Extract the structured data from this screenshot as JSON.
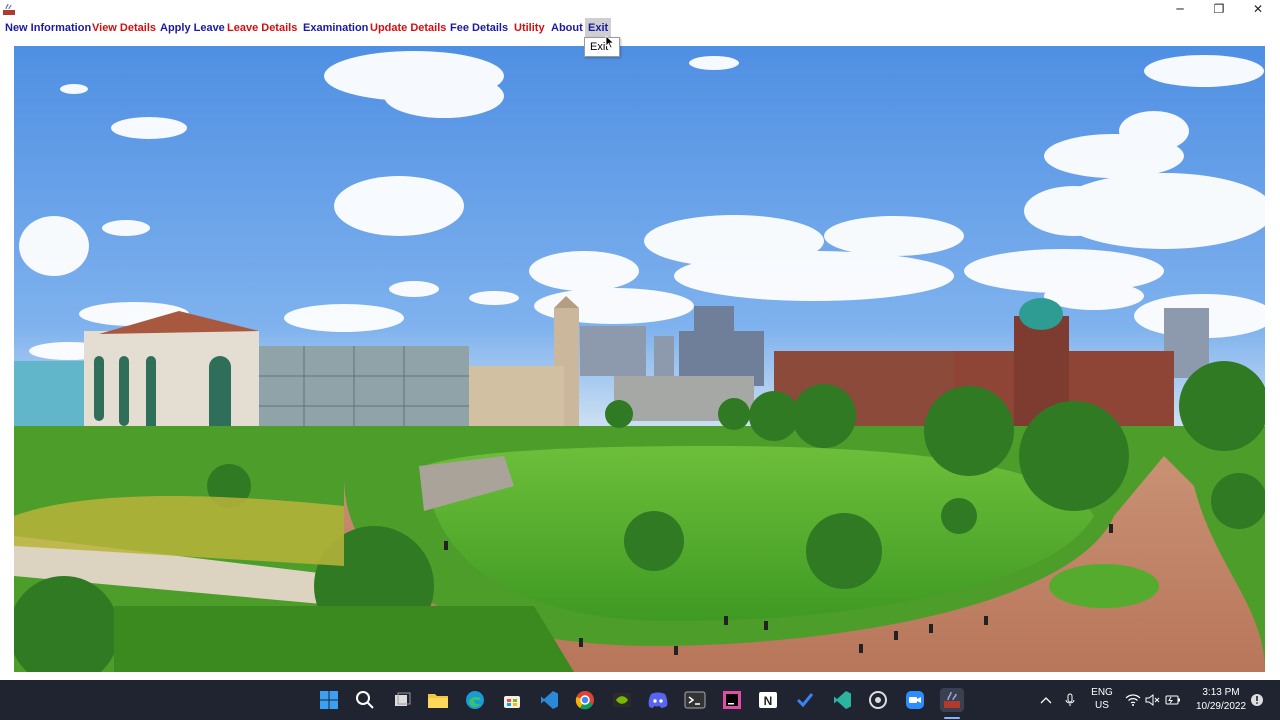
{
  "titlebar": {
    "minimize_glyph": "─",
    "maximize_glyph": "❐",
    "close_glyph": "✕"
  },
  "menu": {
    "items": [
      {
        "label": "New Information",
        "color": "blue"
      },
      {
        "label": "View Details",
        "color": "red"
      },
      {
        "label": "Apply Leave",
        "color": "blue"
      },
      {
        "label": "Leave Details",
        "color": "red"
      },
      {
        "label": "Examination",
        "color": "blue"
      },
      {
        "label": "Update Details",
        "color": "red"
      },
      {
        "label": "Fee Details",
        "color": "blue"
      },
      {
        "label": "Utility",
        "color": "red"
      },
      {
        "label": "About",
        "color": "blue"
      },
      {
        "label": "Exit",
        "color": "blue",
        "active": true
      }
    ],
    "exit_dropdown": [
      "Exit"
    ]
  },
  "colors": {
    "menu_blue": "#1b1ba0",
    "menu_red": "#d01010",
    "taskbar_bg": "#1f2430"
  },
  "main": {
    "background_image": "campus-panorama"
  },
  "taskbar": {
    "icons": [
      "windows-start-icon",
      "search-icon",
      "task-view-icon",
      "file-explorer-icon",
      "edge-icon",
      "store-icon",
      "vscode-icon",
      "chrome-icon",
      "nvidia-icon",
      "discord-icon",
      "terminal-icon",
      "intellij-icon",
      "onenote-icon",
      "todo-icon",
      "visual-studio-icon",
      "github-desktop-icon",
      "zoom-icon",
      "java-app-icon"
    ],
    "tray": {
      "lang_line1": "ENG",
      "lang_line2": "US",
      "time": "3:13 PM",
      "date": "10/29/2022"
    }
  }
}
